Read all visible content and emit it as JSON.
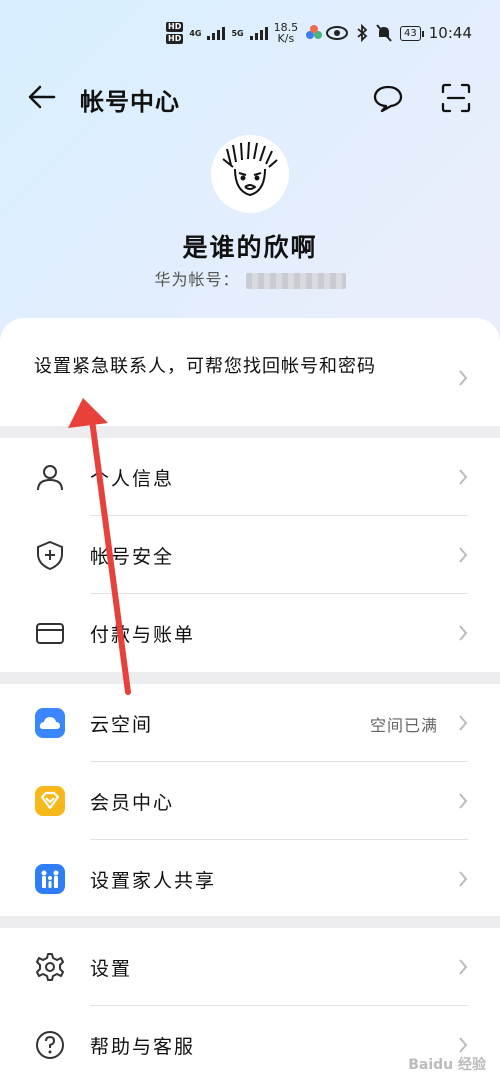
{
  "status_bar": {
    "hd1": "HD",
    "hd2": "HD",
    "network1": "4G",
    "network2": "5G",
    "speed": "18.5",
    "speed_unit": "K/s",
    "battery": "43",
    "time": "10:44"
  },
  "header": {
    "title": "帐号中心"
  },
  "profile": {
    "username": "是谁的欣啊",
    "account_label": "华为帐号："
  },
  "emergency": {
    "text": "设置紧急联系人，可帮您找回帐号和密码"
  },
  "section1": [
    {
      "label": "个人信息",
      "icon": "person-icon"
    },
    {
      "label": "帐号安全",
      "icon": "shield-icon"
    },
    {
      "label": "付款与账单",
      "icon": "card-icon"
    }
  ],
  "section2": [
    {
      "label": "云空间",
      "value": "空间已满",
      "icon": "cloud-icon",
      "color": "#3a86ff"
    },
    {
      "label": "会员中心",
      "icon": "member-icon",
      "color": "#f6b81a"
    },
    {
      "label": "设置家人共享",
      "icon": "family-icon",
      "color": "#2f7ef5"
    }
  ],
  "section3": [
    {
      "label": "设置",
      "icon": "gear-icon"
    },
    {
      "label": "帮助与客服",
      "icon": "help-icon"
    }
  ],
  "annotation_color": "#e8413c",
  "watermark": "Baidu 经验"
}
